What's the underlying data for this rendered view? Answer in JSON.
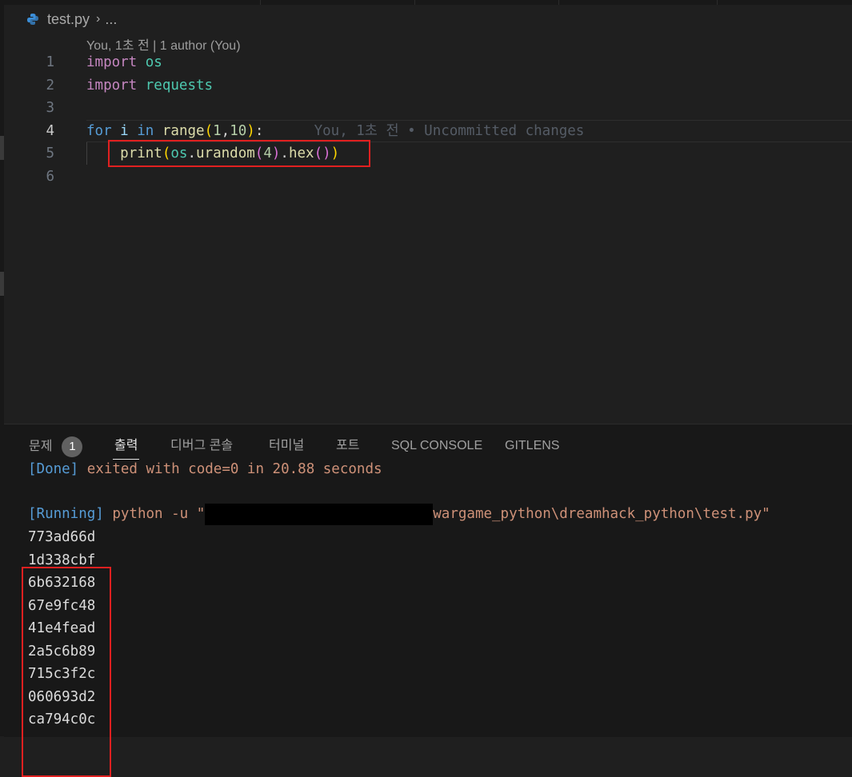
{
  "breadcrumb": {
    "file": "test.py",
    "more": "..."
  },
  "codelens": "You, 1초 전 | 1 author (You)",
  "editor": {
    "line_numbers": [
      "1",
      "2",
      "3",
      "4",
      "5",
      "6"
    ],
    "line1": {
      "kw": "import",
      "mod": "os"
    },
    "line2": {
      "kw": "import",
      "mod": "requests"
    },
    "line4": {
      "for": "for",
      "i": "i",
      "in": "in",
      "range": "range",
      "a": "1",
      "comma": ",",
      "b": "10",
      "close": "):",
      "blame": "You, 1초 전 • Uncommitted changes"
    },
    "line5": {
      "print": "print",
      "os": "os",
      "dot1": ".",
      "urandom": "urandom",
      "n": "4",
      "dot2": ".",
      "hex": "hex"
    }
  },
  "panel": {
    "tabs": [
      "문제",
      "출력",
      "디버그 콘솔",
      "터미널",
      "포트",
      "SQL CONSOLE",
      "GITLENS"
    ],
    "problems_count": "1",
    "active_tab": "출력"
  },
  "output": {
    "done_tag": "[Done]",
    "done_text": " exited with code=0 in 20.88 seconds",
    "running_tag": "[Running]",
    "running_cmd": " python -u \"",
    "running_path": "wargame_python\\dreamhack_python\\test.py\"",
    "hex_lines": [
      "773ad66d",
      "1d338cbf",
      "6b632168",
      "67e9fc48",
      "41e4fead",
      "2a5c6b89",
      "715c3f2c",
      "060693d2",
      "ca794c0c"
    ]
  },
  "colors": {
    "highlight_box": "#e02020",
    "keyword": "#c586c0",
    "module": "#4ec9b0"
  },
  "icons": {
    "file_icon": "python-icon",
    "breadcrumb_sep": "chevron-right-icon"
  }
}
